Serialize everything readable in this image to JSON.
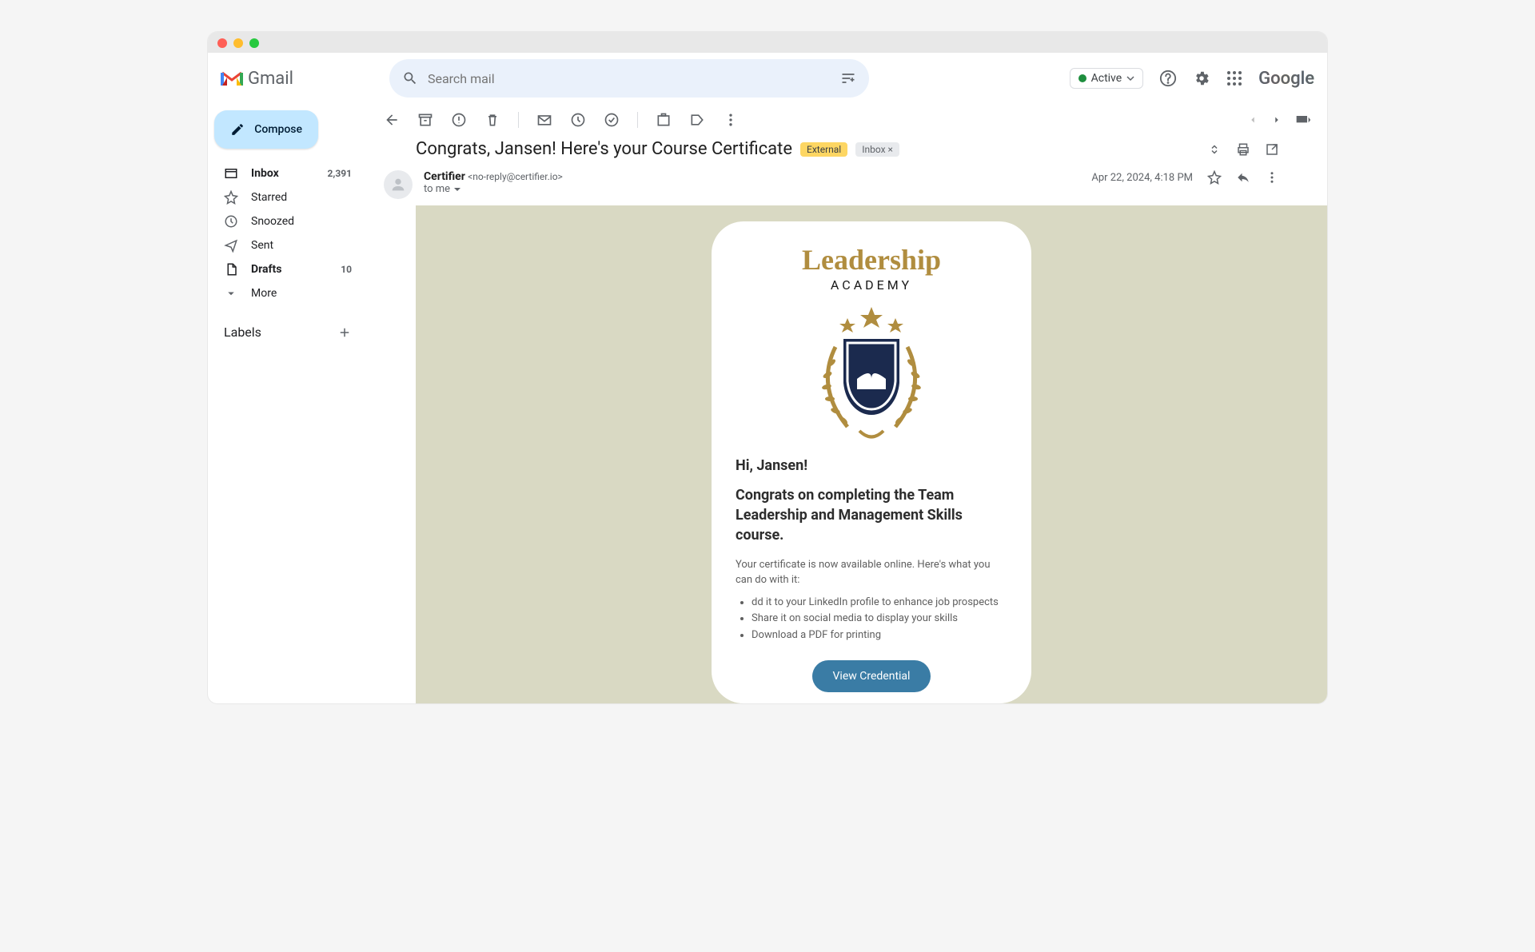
{
  "app_name": "Gmail",
  "search": {
    "placeholder": "Search mail"
  },
  "status": {
    "label": "Active"
  },
  "google_label": "Google",
  "compose_label": "Compose",
  "sidebar": {
    "items": [
      {
        "label": "Inbox",
        "count": "2,391",
        "bold": true
      },
      {
        "label": "Starred"
      },
      {
        "label": "Snoozed"
      },
      {
        "label": "Sent"
      },
      {
        "label": "Drafts",
        "count": "10",
        "bold": true
      },
      {
        "label": "More"
      }
    ],
    "labels_header": "Labels"
  },
  "email": {
    "subject": "Congrats, Jansen! Here's your Course Certificate",
    "badge_external": "External",
    "badge_inbox": "Inbox",
    "sender_name": "Certifier",
    "sender_email": "<no-reply@certifier.io>",
    "to_line": "to me",
    "date": "Apr 22, 2024, 4:18 PM"
  },
  "certificate": {
    "brand_title": "Leadership",
    "brand_sub": "ACADEMY",
    "greeting": "Hi, Jansen!",
    "congrats": "Congrats on completing the Team Leadership and Management Skills course.",
    "description": "Your certificate is now available online. Here's what you can do with it:",
    "bullets": [
      "dd it to your LinkedIn profile to enhance job prospects",
      "Share it on social media to display your skills",
      "Download a PDF for printing"
    ],
    "button": "View Credential"
  }
}
